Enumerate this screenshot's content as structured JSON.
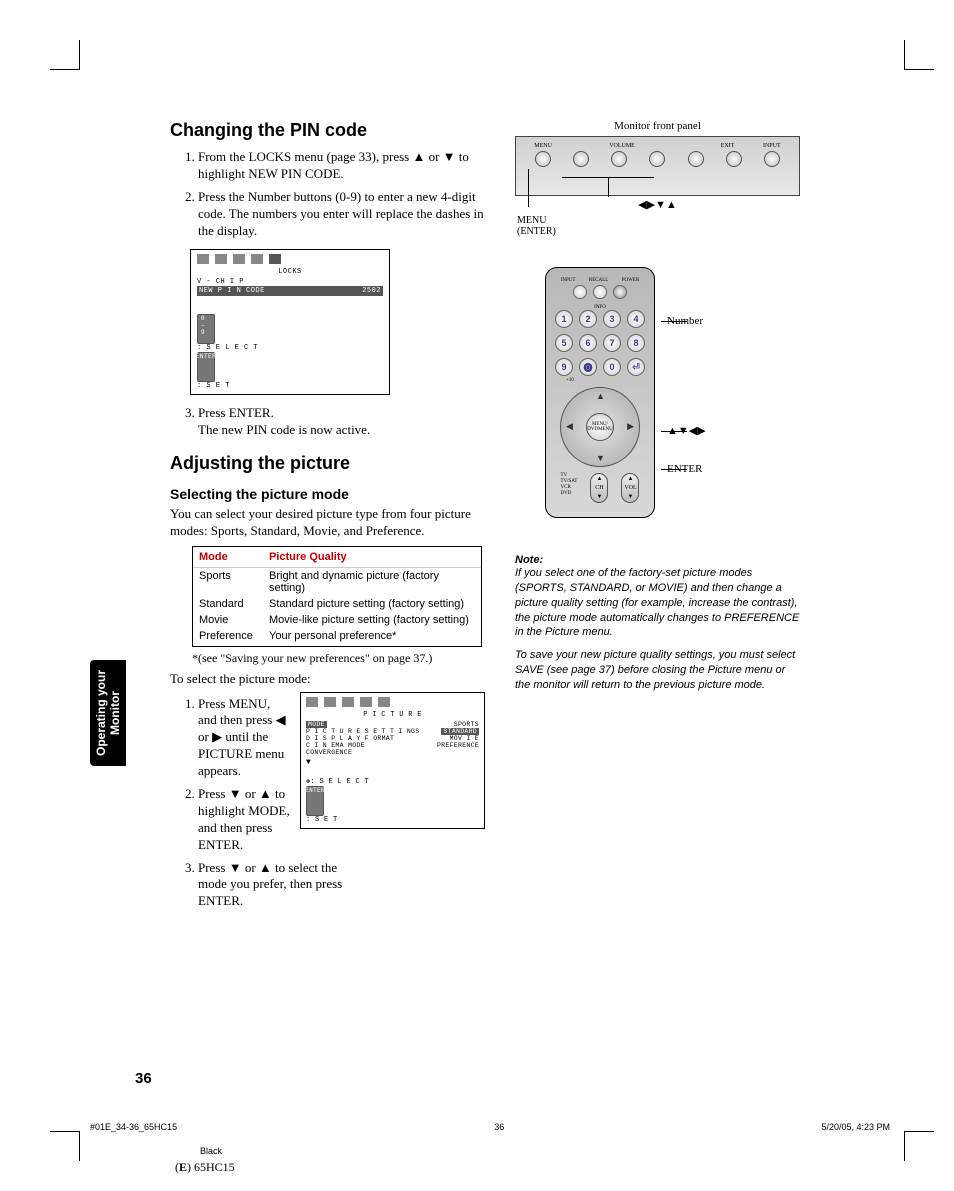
{
  "h1_pin": "Changing the PIN code",
  "pin_steps": [
    "From the LOCKS menu (page 33), press ▲ or ▼ to highlight NEW PIN CODE.",
    "Press the Number buttons (0-9) to enter a new 4-digit code. The numbers you enter will replace the dashes in the display.",
    "Press ENTER.\nThe new PIN code is now active."
  ],
  "osd1": {
    "title": "LOCKS",
    "row1": "V - CH I P",
    "row2_l": "NEW  P I N  CODE",
    "row2_r": "2502",
    "foot_l": "0 – 9",
    "foot_sel": ": S E L E C T",
    "foot_enter": "ENTER",
    "foot_set": ": S E T"
  },
  "h1_pic": "Adjusting the picture",
  "h2_mode": "Selecting the picture mode",
  "mode_intro": "You can select your desired picture type from four picture modes: Sports, Standard, Movie, and Preference.",
  "table": {
    "h1": "Mode",
    "h2": "Picture Quality",
    "rows": [
      {
        "m": "Sports",
        "q": "Bright and dynamic picture (factory setting)"
      },
      {
        "m": "Standard",
        "q": "Standard picture setting (factory setting)"
      },
      {
        "m": "Movie",
        "q": "Movie-like picture setting (factory setting)"
      },
      {
        "m": "Preference",
        "q": "Your personal preference*"
      }
    ]
  },
  "footnote": "*(see \"Saving your new preferences\" on page 37.)",
  "select_intro": "To select the picture mode:",
  "select_steps": [
    "Press MENU, and then press ◀ or ▶ until the PICTURE menu appears.",
    "Press ▼ or ▲ to highlight MODE, and then press ENTER.",
    "Press ▼ or ▲  to select the mode you prefer, then press ENTER."
  ],
  "osd2": {
    "title": "P I C T U R E",
    "rows": [
      {
        "l": "MODE",
        "r": "SPORTS",
        "hl": true
      },
      {
        "l": "P I C T U R E  S E T T I NGS",
        "r": "STANDARD",
        "rhl": true
      },
      {
        "l": "D I S P L A Y  F ORMAT",
        "r": "MOV I E"
      },
      {
        "l": "C I N EMA  MODE",
        "r": "PREFERENCE"
      },
      {
        "l": "CONVERGENCE",
        "r": ""
      }
    ],
    "foot_sel": ": S E L E C T",
    "foot_enter": "ENTER",
    "foot_set": ": S E T"
  },
  "panel_label": "Monitor front panel",
  "panel_top": [
    "MENU",
    "",
    "VOLUME",
    "",
    "",
    "EXIT",
    "INPUT"
  ],
  "panel_vol": [
    "–",
    "+"
  ],
  "panel_arrows": "◀▶▼▲",
  "menu_enter": "MENU\n(ENTER)",
  "remote": {
    "top": [
      "INPUT",
      "RECALL",
      "POWER"
    ],
    "info": "INFO",
    "numbers": [
      "1",
      "2",
      "3",
      "4",
      "5",
      "6",
      "7",
      "8",
      "9",
      "⓿",
      "0",
      "⏎"
    ],
    "plus10": "+10",
    "center": "MENU/\nDVDMENU",
    "ch": "CH",
    "vol": "VOL",
    "side": [
      "TV",
      "TV/SAT",
      "VCR",
      "DVD"
    ]
  },
  "labels": {
    "number": "Number",
    "arrows": "▲▼◀▶",
    "enter": "ENTER"
  },
  "note_h": "Note:",
  "note_p1": "If you select one of the factory-set picture modes (SPORTS, STANDARD, or MOVIE) and then change a picture quality setting (for example, increase the contrast), the picture mode automatically changes to PREFERENCE in the Picture menu.",
  "note_p2": "To save your new picture quality settings, you must select SAVE (see page 37) before closing the Picture menu or the monitor will return to the previous picture mode.",
  "sidetab": "Operating your\nMonitor",
  "pagenum": "36",
  "foot_l": "#01E_34-36_65HC15",
  "foot_c": "36",
  "foot_r": "5/20/05, 4:23 PM",
  "foot2": "Black",
  "foot3_a": "(",
  "foot3_b": "E",
  "foot3_c": ") 65HC15"
}
